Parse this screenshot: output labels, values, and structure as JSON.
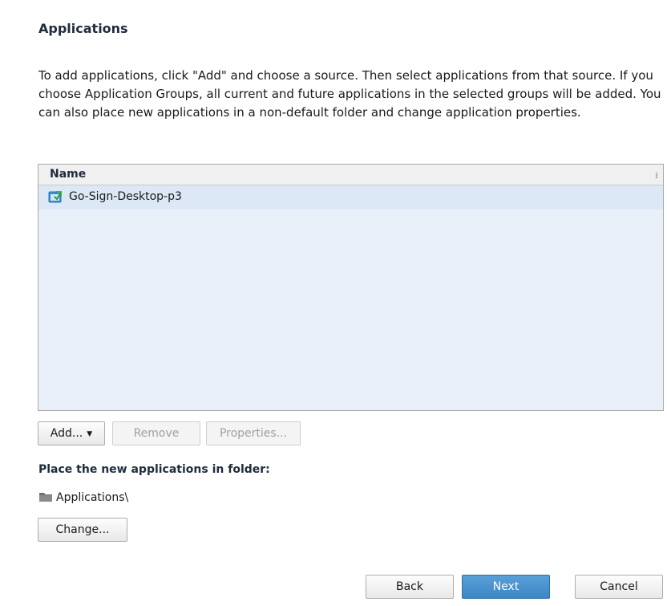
{
  "section": {
    "title": "Applications",
    "description": "To add applications, click \"Add\" and choose a source. Then select applications from that source. If you choose Application Groups, all current and future applications in the selected groups will be added. You can also place new applications in a non-default folder and change application properties."
  },
  "list": {
    "header": "Name",
    "sort_icon": "sort-arrow-icon",
    "items": [
      {
        "label": "Go-Sign-Desktop-p3",
        "icon": "application-icon"
      }
    ]
  },
  "list_buttons": {
    "add_label": "Add...",
    "remove_label": "Remove",
    "properties_label": "Properties..."
  },
  "folder": {
    "label": "Place the new applications in folder:",
    "path": "Applications\\",
    "change_label": "Change..."
  },
  "nav": {
    "back_label": "Back",
    "next_label": "Next",
    "cancel_label": "Cancel"
  },
  "colors": {
    "accent": "#3b86c6",
    "list_background": "#e9f0fa",
    "selected_row": "#dde8f6"
  }
}
